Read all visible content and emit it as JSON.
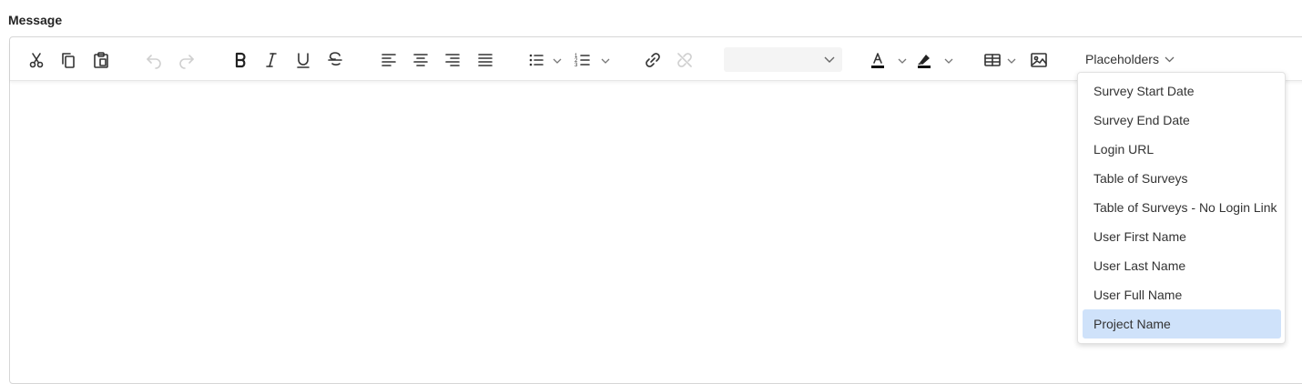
{
  "field_label": "Message",
  "toolbar": {
    "buttons": [
      {
        "name": "cut",
        "icon": "scissors-icon"
      },
      {
        "name": "copy",
        "icon": "copy-icon"
      },
      {
        "name": "paste",
        "icon": "clipboard-icon"
      },
      {
        "name": "undo",
        "icon": "undo-icon"
      },
      {
        "name": "redo",
        "icon": "redo-icon"
      },
      {
        "name": "bold",
        "icon": "bold-icon"
      },
      {
        "name": "italic",
        "icon": "italic-icon"
      },
      {
        "name": "underline",
        "icon": "underline-icon"
      },
      {
        "name": "strikethrough",
        "icon": "strikethrough-icon"
      },
      {
        "name": "align-left",
        "icon": "align-left-icon"
      },
      {
        "name": "align-center",
        "icon": "align-center-icon"
      },
      {
        "name": "align-right",
        "icon": "align-right-icon"
      },
      {
        "name": "justify",
        "icon": "align-justify-icon"
      },
      {
        "name": "bullet-list",
        "icon": "bullet-list-icon"
      },
      {
        "name": "numbered-list",
        "icon": "numbered-list-icon"
      },
      {
        "name": "insert-link",
        "icon": "link-icon"
      },
      {
        "name": "remove-link",
        "icon": "unlink-icon"
      },
      {
        "name": "text-color",
        "icon": "text-color-icon"
      },
      {
        "name": "highlight-color",
        "icon": "highlighter-icon"
      },
      {
        "name": "insert-table",
        "icon": "table-icon"
      },
      {
        "name": "insert-image",
        "icon": "image-icon"
      }
    ],
    "font_select_value": "",
    "placeholders_label": "Placeholders"
  },
  "placeholders_menu": {
    "items": [
      "Survey Start Date",
      "Survey End Date",
      "Login URL",
      "Table of Surveys",
      "Table of Surveys - No Login Link",
      "User First Name",
      "User Last Name",
      "User Full Name",
      "Project Name"
    ],
    "selected": "Project Name"
  },
  "colors": {
    "selected_bg": "#cfe2fa",
    "toolbar_icon": "#333333",
    "disabled_icon": "#a9a9a9"
  }
}
